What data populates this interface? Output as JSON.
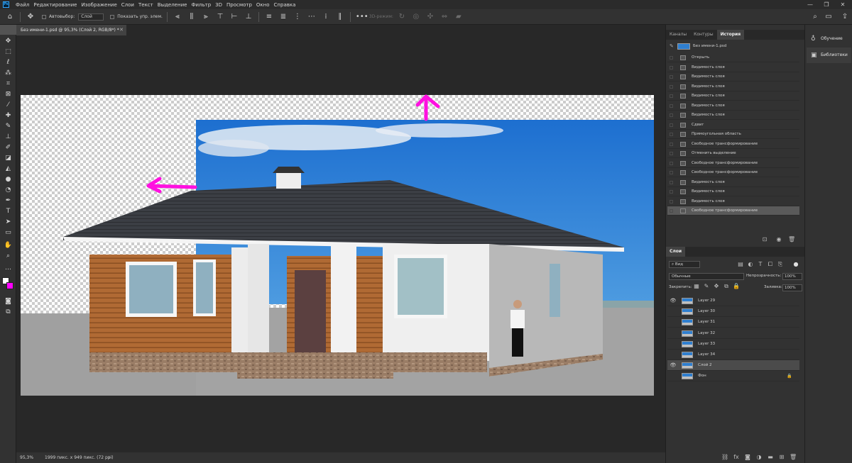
{
  "menubar": {
    "logo": "Ps",
    "items": [
      "Файл",
      "Редактирование",
      "Изображение",
      "Слои",
      "Текст",
      "Выделение",
      "Фильтр",
      "3D",
      "Просмотр",
      "Окно",
      "Справка"
    ],
    "controls": [
      "—",
      "❐",
      "✕"
    ]
  },
  "options": {
    "autoselect_label": "Автовыбор:",
    "autoselect_value": "Слой",
    "show_controls_label": "Показать упр. элем.",
    "mode3d_label": "3D-режим:"
  },
  "document": {
    "tab_title": "Без имени-1.psd @ 95,3% (Слой 2, RGB/8*) *",
    "zoom": "95,3%",
    "info": "1999 пикс. x 949 пикс. (72 ppi)"
  },
  "history": {
    "tabs": [
      "Каналы",
      "Контуры",
      "История"
    ],
    "active_tab": "История",
    "snapshot": "Без имени-1.psd",
    "steps": [
      "Открыть",
      "Видимость слоя",
      "Видимость слоя",
      "Видимость слоя",
      "Видимость слоя",
      "Видимость слоя",
      "Видимость слоя",
      "Сдвиг",
      "Прямоугольная область",
      "Свободное трансформирование",
      "Отменить выделение",
      "Свободное трансформирование",
      "Свободное трансформирование",
      "Видимость слоя",
      "Видимость слоя",
      "Видимость слоя",
      "Свободное трансформирование"
    ],
    "selected_index": 16
  },
  "layers": {
    "tab": "Слои",
    "filter_kind": "Вид",
    "blend_mode": "Обычные",
    "opacity_label": "Непрозрачность:",
    "opacity": "100%",
    "lock_label": "Закрепить:",
    "fill_label": "Заливка:",
    "fill": "100%",
    "items": [
      {
        "name": "Layer 29",
        "visible": true
      },
      {
        "name": "Layer 30",
        "visible": false
      },
      {
        "name": "Layer 31",
        "visible": false
      },
      {
        "name": "Layer 32",
        "visible": false
      },
      {
        "name": "Layer 33",
        "visible": false
      },
      {
        "name": "Layer 34",
        "visible": false
      },
      {
        "name": "Слой 2",
        "visible": true
      },
      {
        "name": "Фон",
        "visible": false
      }
    ],
    "selected_index": 6
  },
  "right_dock": {
    "learn": "Обучение",
    "libraries": "Библиотеки"
  },
  "colors": {
    "foreground": "#ffffff",
    "background": "#ff00ff",
    "arrow": "#ff10e0",
    "sky": "#2e7ed6"
  }
}
